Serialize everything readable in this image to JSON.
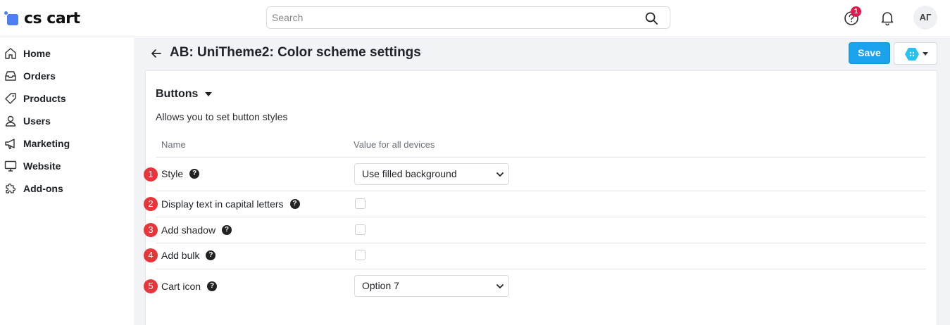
{
  "header": {
    "logo_text": "cs cart",
    "search_placeholder": "Search",
    "notification_count": "1",
    "avatar_initials": "АГ"
  },
  "sidebar": {
    "items": [
      {
        "label": "Home",
        "icon": "home-icon"
      },
      {
        "label": "Orders",
        "icon": "inbox-icon"
      },
      {
        "label": "Products",
        "icon": "tag-icon"
      },
      {
        "label": "Users",
        "icon": "user-icon"
      },
      {
        "label": "Marketing",
        "icon": "megaphone-icon"
      },
      {
        "label": "Website",
        "icon": "monitor-icon"
      },
      {
        "label": "Add-ons",
        "icon": "puzzle-icon"
      }
    ]
  },
  "page": {
    "title": "AB: UniTheme2: Color scheme settings",
    "save_label": "Save"
  },
  "section": {
    "title": "Buttons",
    "description": "Allows you to set button styles",
    "col_name": "Name",
    "col_value": "Value for all devices"
  },
  "rows": [
    {
      "num": "1",
      "label": "Style",
      "type": "select",
      "value": "Use filled background"
    },
    {
      "num": "2",
      "label": "Display text in capital letters",
      "type": "checkbox",
      "checked": false
    },
    {
      "num": "3",
      "label": "Add shadow",
      "type": "checkbox",
      "checked": false
    },
    {
      "num": "4",
      "label": "Add bulk",
      "type": "checkbox",
      "checked": false
    },
    {
      "num": "5",
      "label": "Cart icon",
      "type": "select",
      "value": "Option 7"
    }
  ],
  "colors": {
    "accent": "#1ba2ec",
    "badge": "#e3194b",
    "marker": "#e8353a",
    "logo": "#4f7ff0"
  }
}
